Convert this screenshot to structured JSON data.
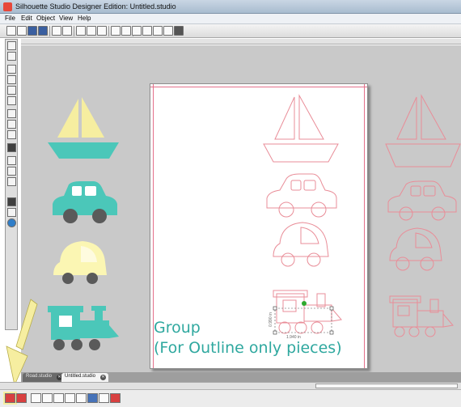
{
  "window": {
    "title": "Silhouette Studio Designer Edition: Untitled.studio"
  },
  "menu": {
    "items": [
      "File",
      "Edit",
      "Object",
      "View",
      "Help"
    ]
  },
  "annotation": {
    "line1": "Group",
    "line2": "(For Outline only pieces)"
  },
  "dimensions": {
    "height": "0.990 in",
    "width": "1.940 in"
  },
  "tabs": [
    {
      "label": "Road.studio",
      "active": false
    },
    {
      "label": "Untitled.studio",
      "active": true
    }
  ],
  "colors": {
    "accent": "#2fa89f",
    "outline": "#e98d98",
    "boat_sail": "#f6eea0",
    "teal": "#4bc7b9",
    "car_yellow": "#fbf6b3",
    "wheel": "#5a5a5a",
    "arrow": "#f6eea0"
  },
  "icons": [
    "new-icon",
    "open-icon",
    "save-icon",
    "print-icon",
    "cut-icon",
    "undo-icon",
    "zoom-in-icon",
    "zoom-out-icon",
    "pan-icon",
    "select-icon",
    "line-icon",
    "rectangle-icon",
    "ellipse-icon",
    "text-icon",
    "eraser-icon",
    "knife-icon",
    "group-icon",
    "ungroup-icon",
    "weld-icon"
  ]
}
